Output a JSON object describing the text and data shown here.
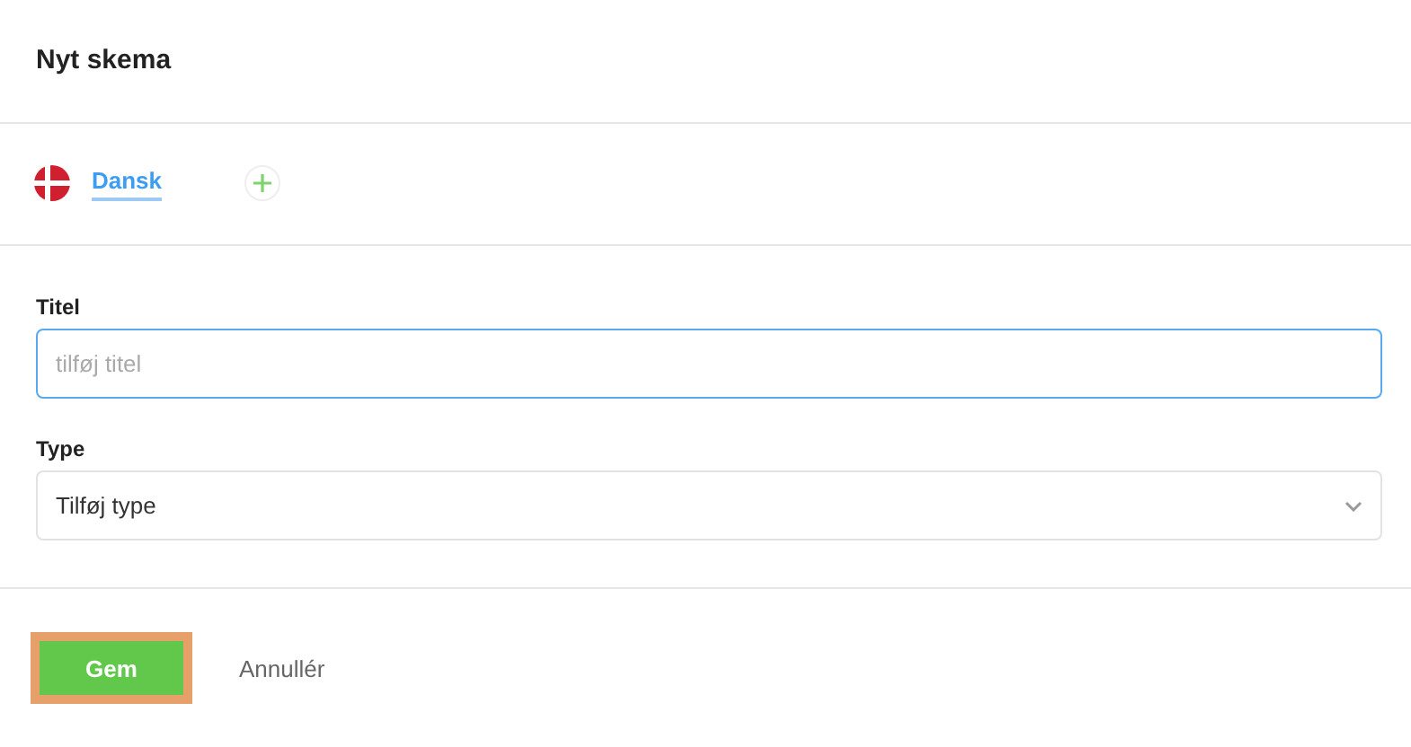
{
  "title": "Nyt skema",
  "languages": [
    {
      "label": "Dansk",
      "selected": true
    }
  ],
  "fields": [
    {
      "kind": "text",
      "label": "Titel",
      "placeholder": "tilføj titel",
      "focused": true
    },
    {
      "kind": "select",
      "label": "Type",
      "value": "Tilføj type",
      "focused": false
    }
  ],
  "actions": [
    {
      "kind": "primary",
      "label": "Gem",
      "highlighted": true
    },
    {
      "kind": "link",
      "label": "Annullér",
      "highlighted": false
    }
  ]
}
